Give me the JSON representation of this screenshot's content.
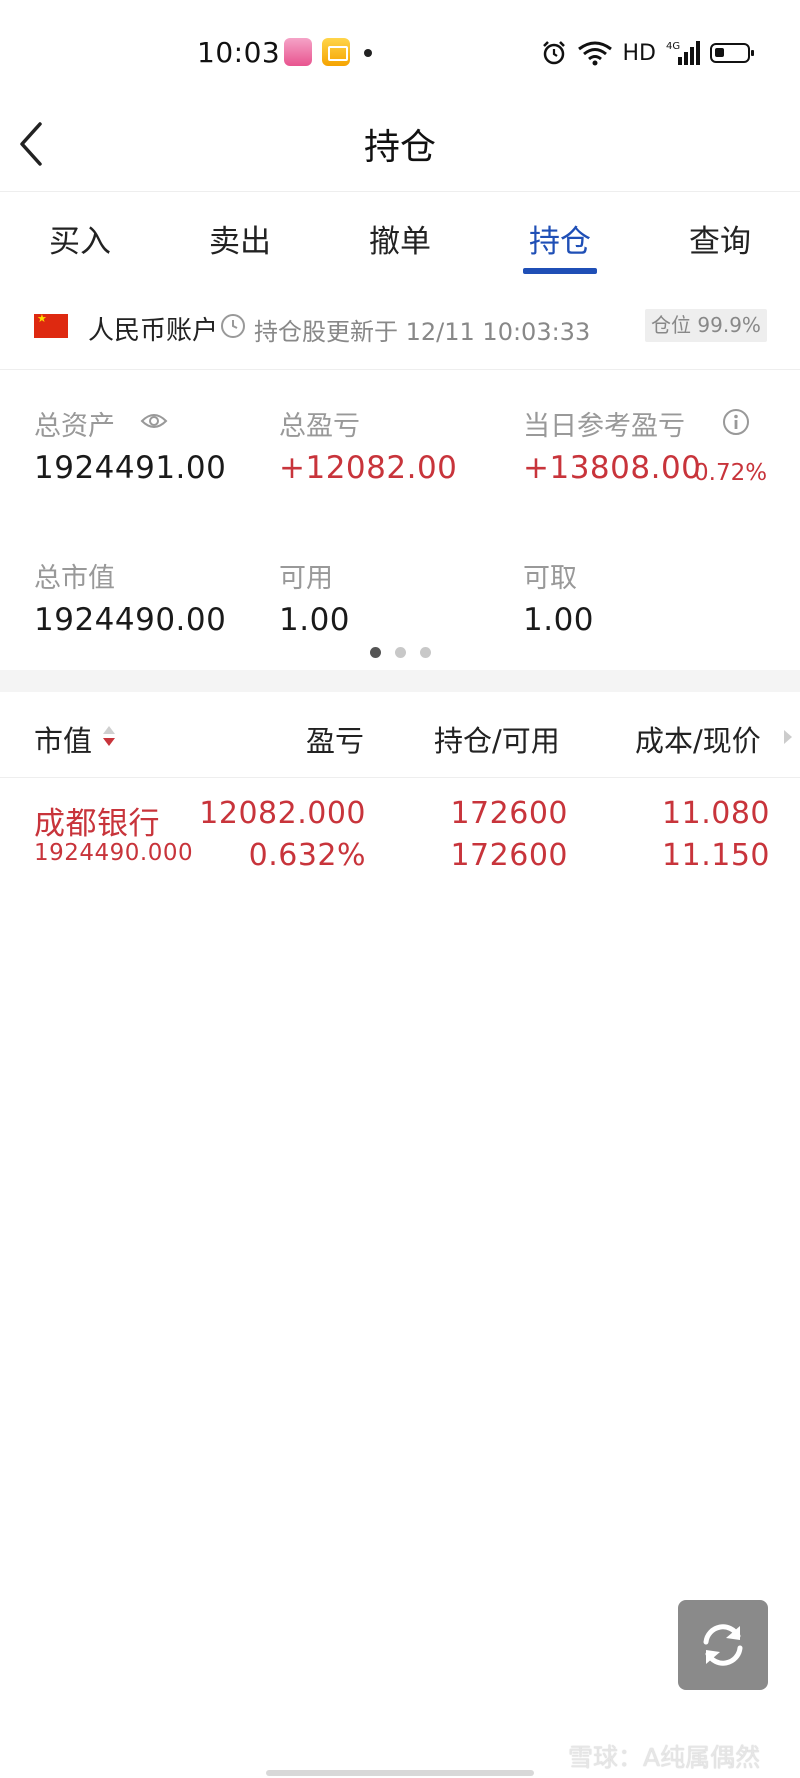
{
  "status_bar": {
    "time": "10:03",
    "network": "HD",
    "signal_label": "4G",
    "icons": [
      "pink-app-icon",
      "mail-app-icon",
      "notification-dot-icon",
      "alarm-icon",
      "wifi-icon",
      "signal-icon",
      "battery-icon"
    ]
  },
  "nav": {
    "title": "持仓",
    "back_icon": "chevron-left-icon"
  },
  "tabs": [
    {
      "label": "买入",
      "active": false
    },
    {
      "label": "卖出",
      "active": false
    },
    {
      "label": "撤单",
      "active": false
    },
    {
      "label": "持仓",
      "active": true
    },
    {
      "label": "查询",
      "active": false
    }
  ],
  "account": {
    "name": "人民币账户",
    "update_text": "持仓股更新于 12/11 10:03:33",
    "position_badge": "仓位 99.9%"
  },
  "summary": {
    "total_assets_label": "总资产",
    "total_assets_value": "1924491.00",
    "total_pnl_label": "总盈亏",
    "total_pnl_value": "+12082.00",
    "daily_pnl_label": "当日参考盈亏",
    "daily_pnl_value": "+13808.00",
    "daily_pnl_pct": "0.72%",
    "market_value_label": "总市值",
    "market_value_value": "1924490.00",
    "available_label": "可用",
    "available_value": "1.00",
    "withdrawable_label": "可取",
    "withdrawable_value": "1.00",
    "page_count": 3,
    "active_page": 1
  },
  "table": {
    "headers": {
      "market_value": "市值",
      "pnl": "盈亏",
      "position": "持仓/可用",
      "cost_price": "成本/现价"
    },
    "rows": [
      {
        "name": "成都银行",
        "market_value": "1924490.000",
        "pnl": "12082.000",
        "pnl_pct": "0.632%",
        "position": "172600",
        "available": "172600",
        "cost": "11.080",
        "price": "11.150"
      }
    ]
  },
  "watermark": "雪球：A纯属偶然",
  "colors": {
    "accent_blue": "#1f4fb6",
    "profit_red": "#c8343b",
    "label_gray": "#999999"
  }
}
